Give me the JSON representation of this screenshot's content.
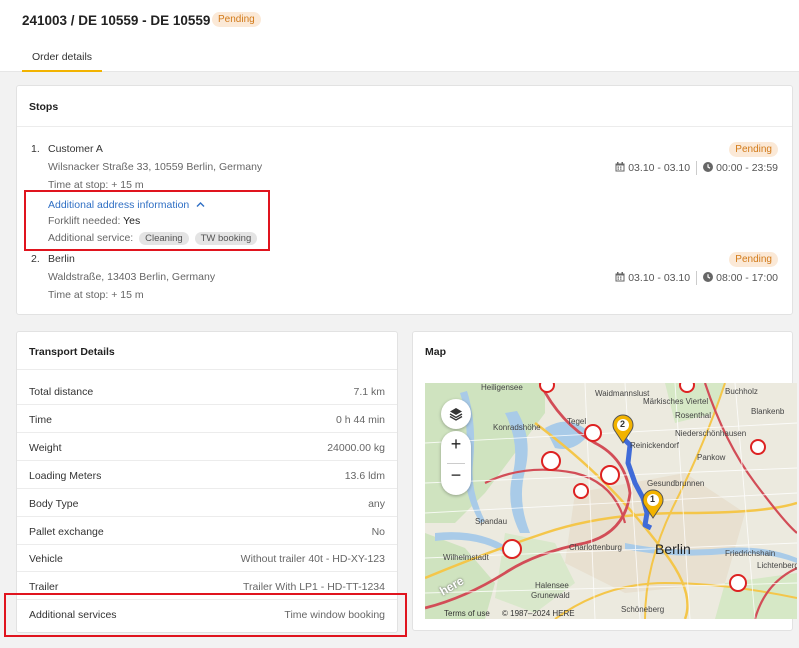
{
  "header": {
    "title": "241003 / DE 10559 - DE 10559",
    "status": "Pending",
    "tab": "Order details"
  },
  "stops": {
    "title": "Stops",
    "items": [
      {
        "number": "1.",
        "name": "Customer A",
        "address": "Wilsnacker Straße 33, 10559 Berlin, Germany",
        "time_at_stop": "Time at stop: + 15 m",
        "status": "Pending",
        "date_range": "03.10 - 03.10",
        "time_range": "00:00 - 23:59",
        "additional_link": "Additional address information",
        "forklift_label": "Forklift needed:",
        "forklift_value": "Yes",
        "service_label": "Additional service:",
        "services": [
          "Cleaning",
          "TW booking"
        ]
      },
      {
        "number": "2.",
        "name": "Berlin",
        "address": "Waldstraße, 13403 Berlin, Germany",
        "time_at_stop": "Time at stop: + 15 m",
        "status": "Pending",
        "date_range": "03.10 - 03.10",
        "time_range": "08:00 - 17:00"
      }
    ]
  },
  "transport": {
    "title": "Transport Details",
    "rows": [
      {
        "label": "Total distance",
        "value": "7.1 km"
      },
      {
        "label": "Time",
        "value": "0 h 44 min"
      },
      {
        "label": "Weight",
        "value": "24000.00 kg"
      },
      {
        "label": "Loading Meters",
        "value": "13.6 ldm"
      },
      {
        "label": "Body Type",
        "value": "any"
      },
      {
        "label": "Pallet exchange",
        "value": "No"
      },
      {
        "label": "Vehicle",
        "value": "Without trailer 40t - HD-XY-123"
      },
      {
        "label": "Trailer",
        "value": "Trailer With LP1 - HD-TT-1234"
      },
      {
        "label": "Additional services",
        "value": "Time window booking"
      }
    ]
  },
  "map": {
    "title": "Map",
    "zoom_in": "+",
    "zoom_out": "−",
    "city_label": "Berlin",
    "place_labels": [
      "Heiligensee",
      "Waidmannslust",
      "Konradshöhe",
      "Tegel",
      "Reinickendorf",
      "Niederschönhausen",
      "Pankow",
      "Gesundbrunnen",
      "Spandau",
      "Charlottenburg",
      "Wilhelmstadt",
      "Halensee",
      "Grunewald",
      "Schöneberg",
      "Friedrichshain",
      "Lichtenberg",
      "Buchholz",
      "Blankenb",
      "Märkisches Viertel",
      "Rosenthal"
    ],
    "markers": [
      "2",
      "1"
    ],
    "terms": "Terms of use",
    "copyright": "© 1987–2024 HERE",
    "logo": "here"
  },
  "colors": {
    "accent": "#f2b300",
    "pending_bg": "#fbe9d7",
    "pending_text": "#d27a18",
    "link": "#2f6fc4",
    "highlight": "#e0141e"
  }
}
